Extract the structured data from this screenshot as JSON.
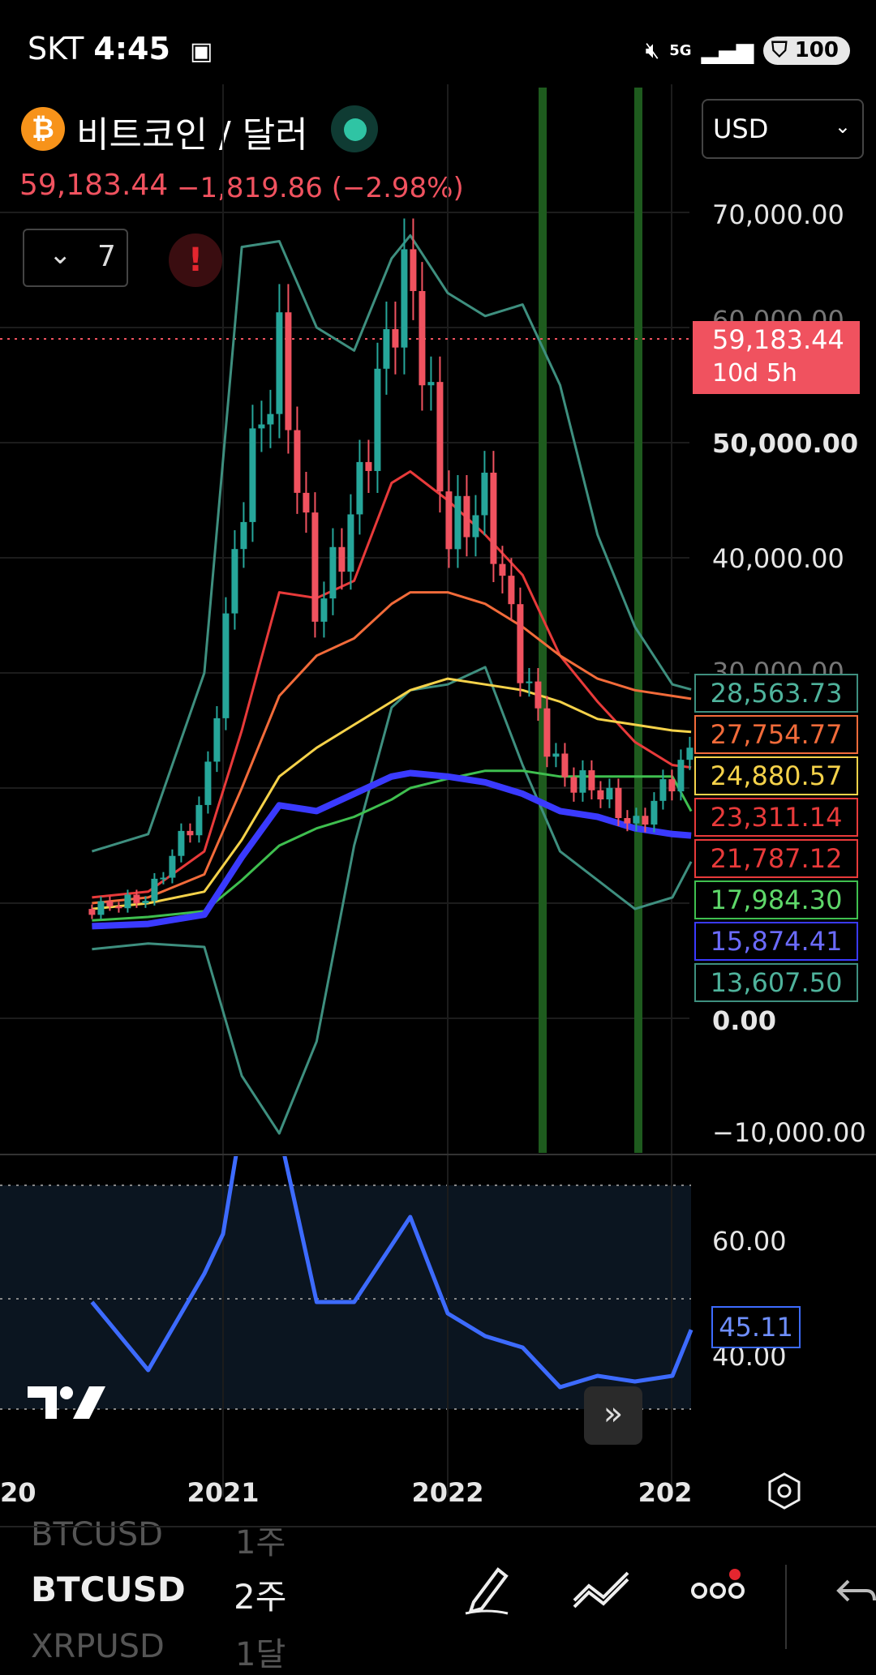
{
  "status_bar": {
    "carrier": "SKT",
    "time": "4:45",
    "network": "5G",
    "battery": "100"
  },
  "header": {
    "symbol_title": "비트코인 / 달러",
    "currency": "USD",
    "last_price": "59,183.44",
    "change": "−1,819.86 (−2.98%)",
    "indicators_count": "7",
    "alert_icon": "exclamation-icon"
  },
  "price_scale": {
    "ticks": [
      "70,000.00",
      "50,000.00",
      "40,000.00",
      "0.00",
      "−10,000.00"
    ],
    "partial_ticks": [
      "60,000.00",
      "30,000.00"
    ],
    "current_price_label": "59,183.44",
    "countdown": "10d 5h",
    "indicator_labels": [
      {
        "value": "28,563.73",
        "color": "#3e8f7f",
        "text_color": "#4fb39c"
      },
      {
        "value": "27,754.77",
        "color": "#f26b3a",
        "text_color": "#f26b3a"
      },
      {
        "value": "24,880.57",
        "color": "#f5d24a",
        "text_color": "#f5d24a"
      },
      {
        "value": "23,311.14",
        "color": "#e83a3a",
        "text_color": "#e83a3a"
      },
      {
        "value": "21,787.12",
        "color": "#e83a3a",
        "text_color": "#e83a3a"
      },
      {
        "value": "17,984.30",
        "color": "#3fbf4f",
        "text_color": "#5fd86a"
      },
      {
        "value": "15,874.41",
        "color": "#3a3aff",
        "text_color": "#6b6bff"
      },
      {
        "value": "13,607.50",
        "color": "#3e8f7f",
        "text_color": "#4fb39c"
      }
    ]
  },
  "rsi_scale": {
    "ticks": [
      "60.00",
      "40.00"
    ],
    "current_label": "45.11"
  },
  "time_axis": {
    "labels": [
      "20",
      "2021",
      "2022",
      "202"
    ]
  },
  "bottom_bar": {
    "prev_symbol": "BTCUSD",
    "prev_tf": "1주",
    "symbol": "BTCUSD",
    "timeframe": "2주",
    "next_symbol": "XRPUSD",
    "next_tf": "1달"
  },
  "colors": {
    "up": "#26a69a",
    "down": "#f0525f",
    "rsi": "#3d6bff",
    "highlight_green": "#1e5b1e"
  },
  "chart_data": [
    {
      "type": "line",
      "title": "",
      "xlabel": "",
      "ylabel": "",
      "ylim": [
        -11000,
        74000
      ],
      "x": [
        "2020-06",
        "2020-09",
        "2020-12",
        "2021-02",
        "2021-04",
        "2021-06",
        "2021-08",
        "2021-10",
        "2021-11",
        "2022-01",
        "2022-03",
        "2022-05",
        "2022-07",
        "2022-09",
        "2022-11",
        "2023-01",
        "2023-02"
      ],
      "series": [
        {
          "name": "",
          "color": "#26a69a",
          "values": [
            9500,
            10500,
            19000,
            45000,
            58000,
            35000,
            44000,
            61000,
            65000,
            42000,
            45000,
            30000,
            21000,
            20000,
            16500,
            21000,
            23000
          ]
        },
        {
          "name": "",
          "color": "#3e8f7f",
          "values": [
            14500,
            16000,
            30000,
            67000,
            67500,
            60000,
            58000,
            66000,
            68000,
            63000,
            61000,
            62000,
            55000,
            42000,
            34000,
            29000,
            28563.73
          ]
        },
        {
          "name": "",
          "color": "#3e8f7f",
          "values": [
            6000,
            6500,
            6200,
            -5000,
            -10000,
            -2000,
            15000,
            27000,
            28500,
            29000,
            30500,
            22000,
            14500,
            12000,
            9500,
            10500,
            13607.5
          ]
        },
        {
          "name": "",
          "color": "#e83a3a",
          "values": [
            10500,
            11000,
            14500,
            25000,
            37000,
            36500,
            38000,
            46500,
            47500,
            45000,
            42000,
            38500,
            31500,
            27500,
            24000,
            22000,
            21787.12
          ]
        },
        {
          "name": "",
          "color": "#f26b3a",
          "values": [
            10000,
            10500,
            12500,
            20000,
            28000,
            31500,
            33000,
            36000,
            37000,
            37000,
            36000,
            34000,
            31500,
            29500,
            28500,
            28000,
            27754.77
          ]
        },
        {
          "name": "",
          "color": "#f5d24a",
          "values": [
            9500,
            10000,
            11000,
            15500,
            21000,
            23500,
            25500,
            27500,
            28500,
            29500,
            29000,
            28500,
            27500,
            26000,
            25500,
            25000,
            24880.57
          ]
        },
        {
          "name": "",
          "color": "#3fbf4f",
          "values": [
            8500,
            8800,
            9300,
            12000,
            15000,
            16500,
            17500,
            19000,
            20000,
            20800,
            21500,
            21500,
            21000,
            21000,
            21000,
            21000,
            17984.3
          ]
        },
        {
          "name": "",
          "color": "#3a3aff",
          "values": [
            8000,
            8200,
            9000,
            14000,
            18500,
            18000,
            19500,
            21000,
            21300,
            21000,
            20500,
            19500,
            18000,
            17500,
            16500,
            16000,
            15874.41
          ]
        }
      ]
    },
    {
      "type": "line",
      "title": "",
      "ylim": [
        25,
        75
      ],
      "x": [
        "2020-06",
        "2020-09",
        "2020-12",
        "2021-01",
        "2021-02",
        "2021-04",
        "2021-06",
        "2021-08",
        "2021-10",
        "2021-11",
        "2022-01",
        "2022-03",
        "2022-05",
        "2022-07",
        "2022-09",
        "2022-11",
        "2023-01",
        "2023-02"
      ],
      "series": [
        {
          "name": "",
          "color": "#3d6bff",
          "values": [
            50,
            38,
            55,
            62,
            82,
            80,
            50,
            50,
            60,
            65,
            48,
            44,
            42,
            35,
            37,
            36,
            37,
            45.11
          ]
        }
      ]
    }
  ]
}
